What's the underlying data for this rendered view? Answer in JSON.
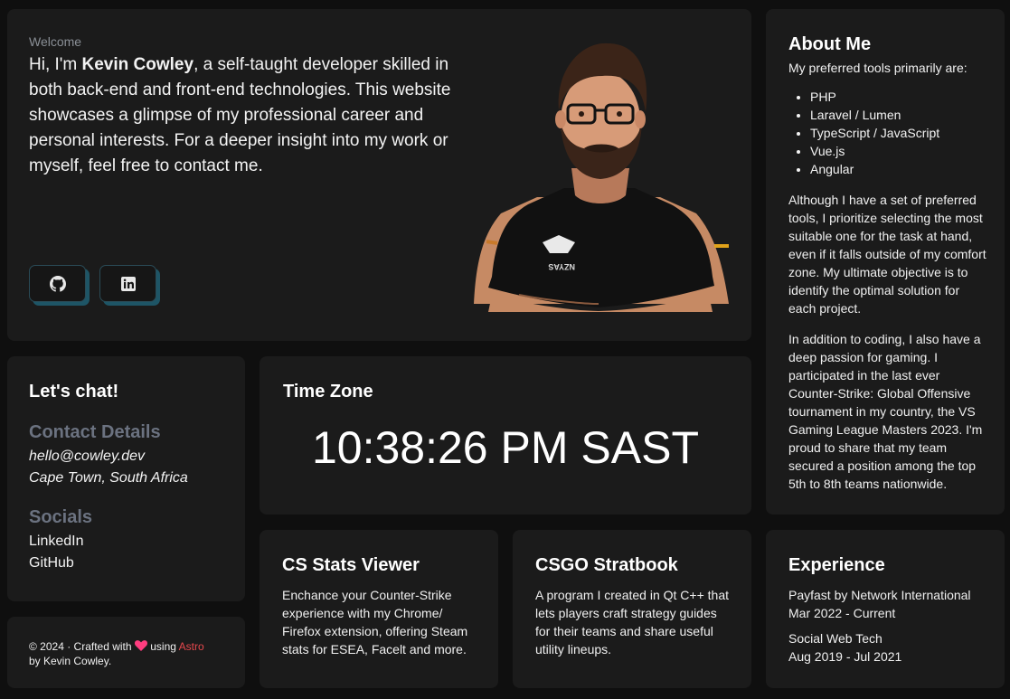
{
  "hero": {
    "welcome": "Welcome",
    "intro_prefix": "Hi, I'm ",
    "name": "Kevin Cowley",
    "intro_suffix": ", a self-taught developer skilled in both back-end and front-end technologies. This website showcases a glimpse of my professional career and personal interests. For a deeper insight into my work or myself, feel free to contact me.",
    "buttons": [
      {
        "icon": "github-icon",
        "label": "GitHub"
      },
      {
        "icon": "linkedin-icon",
        "label": "LinkedIn"
      }
    ],
    "shirt_logo_text": "NZYAS"
  },
  "about": {
    "title": "About Me",
    "lead": "My preferred tools primarily are:",
    "tools": [
      "PHP",
      "Laravel / Lumen",
      "TypeScript / JavaScript",
      "Vue.js",
      "Angular"
    ],
    "p1": "Although I have a set of preferred tools, I prioritize selecting the most suitable one for the task at hand, even if it falls outside of my comfort zone. My ultimate objective is to identify the optimal solution for each project.",
    "p2": "In addition to coding, I also have a deep passion for gaming. I participated in the last ever Counter-Strike: Global Offensive tournament in my country, the VS Gaming League Masters 2023. I'm proud to share that my team secured a position among the top 5th to 8th teams nationwide."
  },
  "chat": {
    "title": "Let's chat!",
    "contact_heading": "Contact Details",
    "email": "hello@cowley.dev",
    "location": "Cape Town, South Africa",
    "socials_heading": "Socials",
    "socials": [
      "LinkedIn",
      "GitHub"
    ]
  },
  "timezone": {
    "title": "Time Zone",
    "clock": "10:38:26 PM SAST"
  },
  "footer": {
    "prefix": "© 2024 · Crafted with",
    "using": "using",
    "astro": "Astro",
    "byline": "by Kevin Cowley."
  },
  "projects": [
    {
      "title": "CS Stats Viewer",
      "desc": "Enchance your Counter-Strike experience with my Chrome/ Firefox extension, offering Steam stats for ESEA, Facelt and more."
    },
    {
      "title": "CSGO Stratbook",
      "desc": "A program I created in Qt C++ that lets players craft strategy guides for their teams and share useful utility lineups."
    }
  ],
  "experience": {
    "title": "Experience",
    "jobs": [
      {
        "company": "Payfast by Network International",
        "period": "Mar 2022 - Current"
      },
      {
        "company": "Social Web Tech",
        "period": "Aug 2019 - Jul 2021"
      }
    ]
  },
  "colors": {
    "background": "#0f0f0f",
    "card": "#1b1b1b",
    "muted_heading": "#6b7280",
    "accent_shadow": "#1e5566",
    "astro_link": "#e5484d",
    "heart": "#ff3d7f"
  }
}
